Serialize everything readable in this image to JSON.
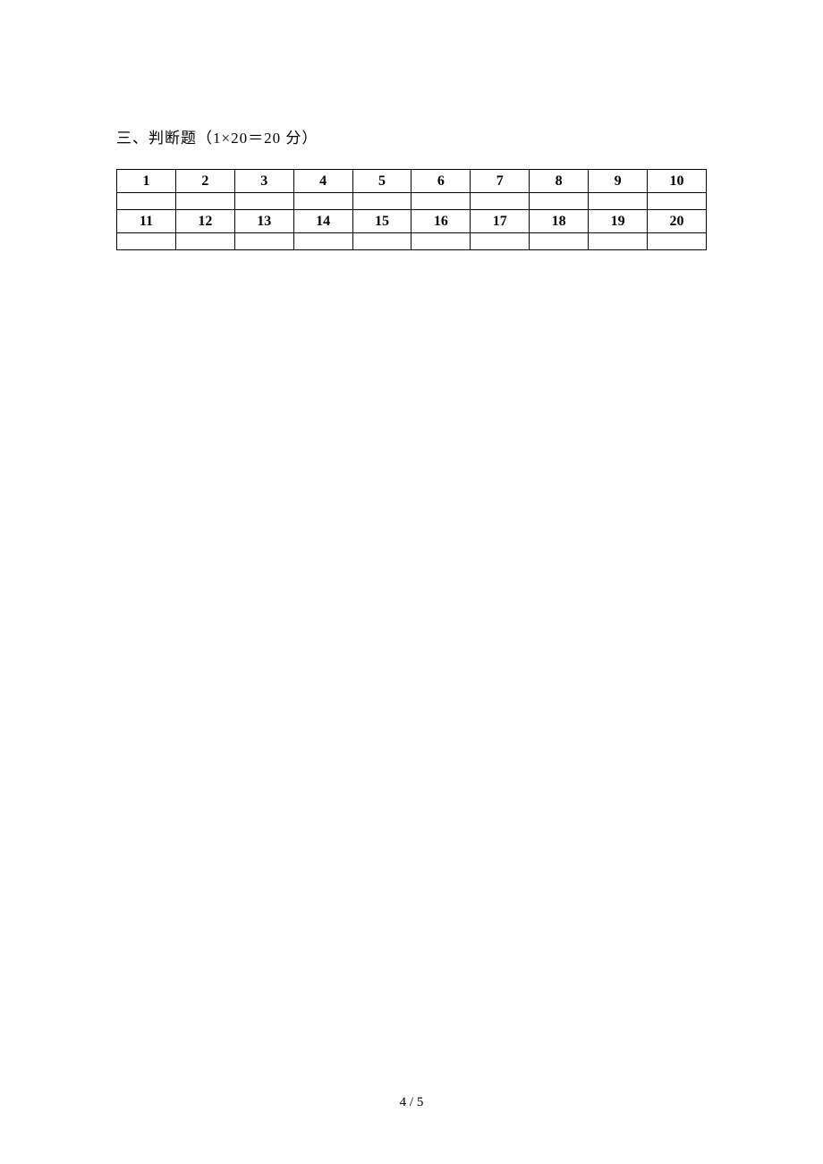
{
  "section": {
    "title": "三、判断题（1×20＝20 分）"
  },
  "grid": {
    "row1": [
      "1",
      "2",
      "3",
      "4",
      "5",
      "6",
      "7",
      "8",
      "9",
      "10"
    ],
    "row1_answers": [
      "",
      "",
      "",
      "",
      "",
      "",
      "",
      "",
      "",
      ""
    ],
    "row2": [
      "11",
      "12",
      "13",
      "14",
      "15",
      "16",
      "17",
      "18",
      "19",
      "20"
    ],
    "row2_answers": [
      "",
      "",
      "",
      "",
      "",
      "",
      "",
      "",
      "",
      ""
    ]
  },
  "footer": {
    "page_number": "4 / 5"
  }
}
